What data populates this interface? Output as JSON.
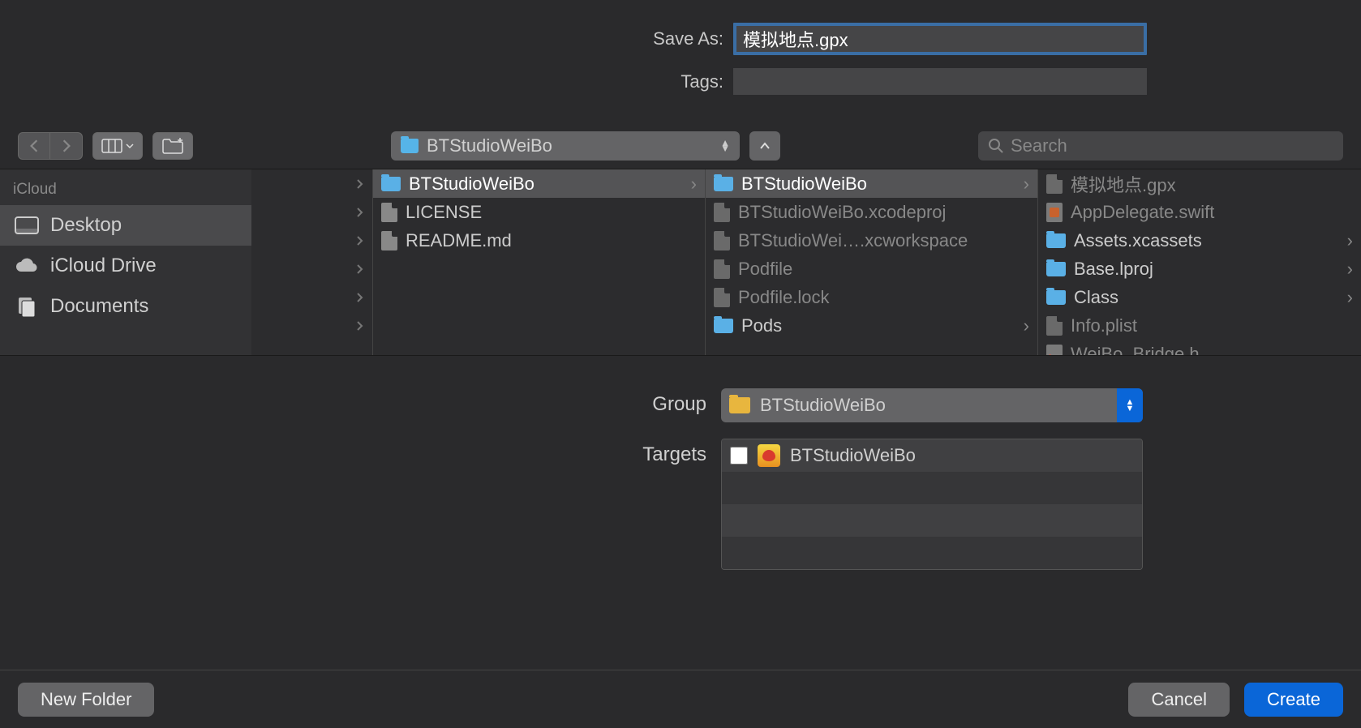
{
  "saveAs": {
    "label": "Save As:",
    "value": "模拟地点.gpx"
  },
  "tags": {
    "label": "Tags:",
    "value": ""
  },
  "path": {
    "current": "BTStudioWeiBo"
  },
  "search": {
    "placeholder": "Search"
  },
  "sidebar": {
    "header": "iCloud",
    "items": [
      {
        "label": "Desktop"
      },
      {
        "label": "iCloud Drive"
      },
      {
        "label": "Documents"
      }
    ]
  },
  "columns": [
    [
      {
        "label": "BTStudioWeiBo",
        "type": "folder",
        "selected": true,
        "hasChildren": true
      },
      {
        "label": "LICENSE",
        "type": "doc"
      },
      {
        "label": "README.md",
        "type": "doc"
      }
    ],
    [
      {
        "label": "BTStudioWeiBo",
        "type": "folder",
        "selected": true,
        "hasChildren": true
      },
      {
        "label": "BTStudioWeiBo.xcodeproj",
        "type": "proj",
        "dim": true
      },
      {
        "label": "BTStudioWei….xcworkspace",
        "type": "proj",
        "dim": true
      },
      {
        "label": "Podfile",
        "type": "doc",
        "dim": true
      },
      {
        "label": "Podfile.lock",
        "type": "doc",
        "dim": true
      },
      {
        "label": "Pods",
        "type": "folder",
        "hasChildren": true
      }
    ],
    [
      {
        "label": "模拟地点.gpx",
        "type": "doc",
        "dim": true
      },
      {
        "label": "AppDelegate.swift",
        "type": "swift",
        "dim": true
      },
      {
        "label": "Assets.xcassets",
        "type": "folder",
        "hasChildren": true
      },
      {
        "label": "Base.lproj",
        "type": "folder",
        "hasChildren": true
      },
      {
        "label": "Class",
        "type": "folder",
        "hasChildren": true
      },
      {
        "label": "Info.plist",
        "type": "doc",
        "dim": true
      },
      {
        "label": "WeiBo_Bridge.h",
        "type": "h",
        "dim": true
      }
    ]
  ],
  "group": {
    "label": "Group",
    "value": "BTStudioWeiBo"
  },
  "targets": {
    "label": "Targets",
    "items": [
      {
        "label": "BTStudioWeiBo",
        "checked": false
      }
    ]
  },
  "footer": {
    "newFolder": "New Folder",
    "cancel": "Cancel",
    "create": "Create"
  }
}
